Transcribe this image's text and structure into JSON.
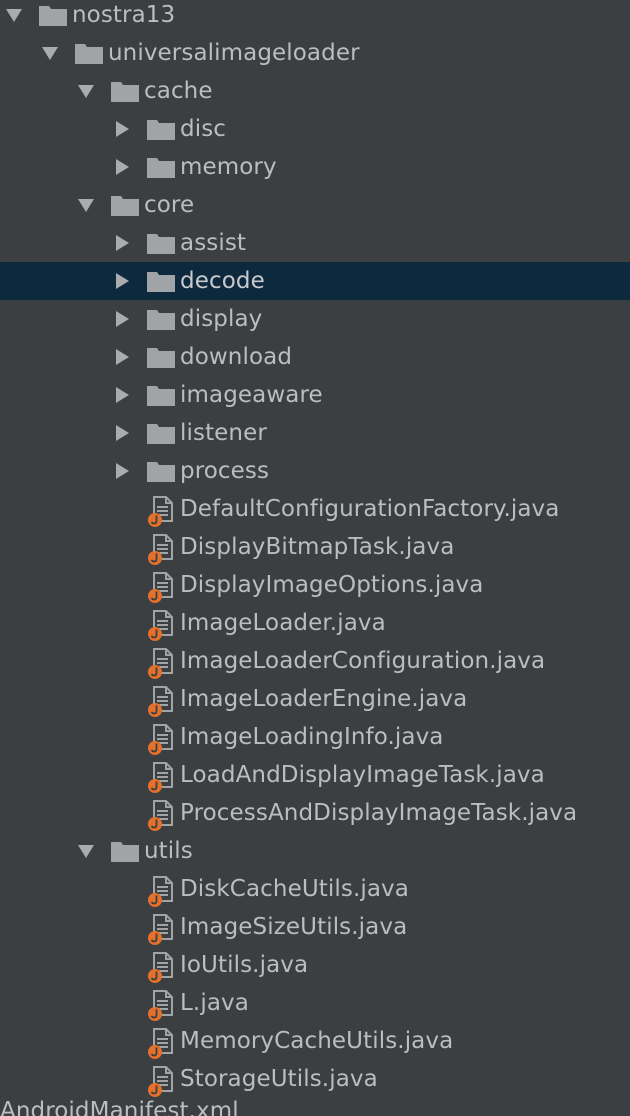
{
  "tree": {
    "nodes": [
      {
        "type": "folder",
        "depth": 0,
        "expanded": true,
        "label": "nostra13"
      },
      {
        "type": "folder",
        "depth": 1,
        "expanded": true,
        "label": "universalimageloader"
      },
      {
        "type": "folder",
        "depth": 2,
        "expanded": true,
        "label": "cache"
      },
      {
        "type": "folder",
        "depth": 3,
        "expanded": false,
        "label": "disc"
      },
      {
        "type": "folder",
        "depth": 3,
        "expanded": false,
        "label": "memory"
      },
      {
        "type": "folder",
        "depth": 2,
        "expanded": true,
        "label": "core"
      },
      {
        "type": "folder",
        "depth": 3,
        "expanded": false,
        "label": "assist"
      },
      {
        "type": "folder",
        "depth": 3,
        "expanded": false,
        "label": "decode",
        "selected": true
      },
      {
        "type": "folder",
        "depth": 3,
        "expanded": false,
        "label": "display"
      },
      {
        "type": "folder",
        "depth": 3,
        "expanded": false,
        "label": "download"
      },
      {
        "type": "folder",
        "depth": 3,
        "expanded": false,
        "label": "imageaware"
      },
      {
        "type": "folder",
        "depth": 3,
        "expanded": false,
        "label": "listener"
      },
      {
        "type": "folder",
        "depth": 3,
        "expanded": false,
        "label": "process"
      },
      {
        "type": "file",
        "depth": 3,
        "label": "DefaultConfigurationFactory.java"
      },
      {
        "type": "file",
        "depth": 3,
        "label": "DisplayBitmapTask.java"
      },
      {
        "type": "file",
        "depth": 3,
        "label": "DisplayImageOptions.java"
      },
      {
        "type": "file",
        "depth": 3,
        "label": "ImageLoader.java"
      },
      {
        "type": "file",
        "depth": 3,
        "label": "ImageLoaderConfiguration.java"
      },
      {
        "type": "file",
        "depth": 3,
        "label": "ImageLoaderEngine.java"
      },
      {
        "type": "file",
        "depth": 3,
        "label": "ImageLoadingInfo.java"
      },
      {
        "type": "file",
        "depth": 3,
        "label": "LoadAndDisplayImageTask.java"
      },
      {
        "type": "file",
        "depth": 3,
        "label": "ProcessAndDisplayImageTask.java"
      },
      {
        "type": "folder",
        "depth": 2,
        "expanded": true,
        "label": "utils"
      },
      {
        "type": "file",
        "depth": 3,
        "label": "DiskCacheUtils.java"
      },
      {
        "type": "file",
        "depth": 3,
        "label": "ImageSizeUtils.java"
      },
      {
        "type": "file",
        "depth": 3,
        "label": "IoUtils.java"
      },
      {
        "type": "file",
        "depth": 3,
        "label": "L.java"
      },
      {
        "type": "file",
        "depth": 3,
        "label": "MemoryCacheUtils.java"
      },
      {
        "type": "file",
        "depth": 3,
        "label": "StorageUtils.java"
      }
    ],
    "cut_off_label": "AndroidManifest.xml"
  },
  "colors": {
    "background": "#3c3f41",
    "selection": "#0d293e",
    "text": "#bbbdc0",
    "folder_icon": "#a1a4a7",
    "arrow": "#a9abae",
    "java_badge": "#e3702d"
  },
  "icons": {
    "folder": "folder-icon",
    "file": "java-file-icon",
    "expanded_arrow": "chevron-down-icon",
    "collapsed_arrow": "chevron-right-icon"
  }
}
